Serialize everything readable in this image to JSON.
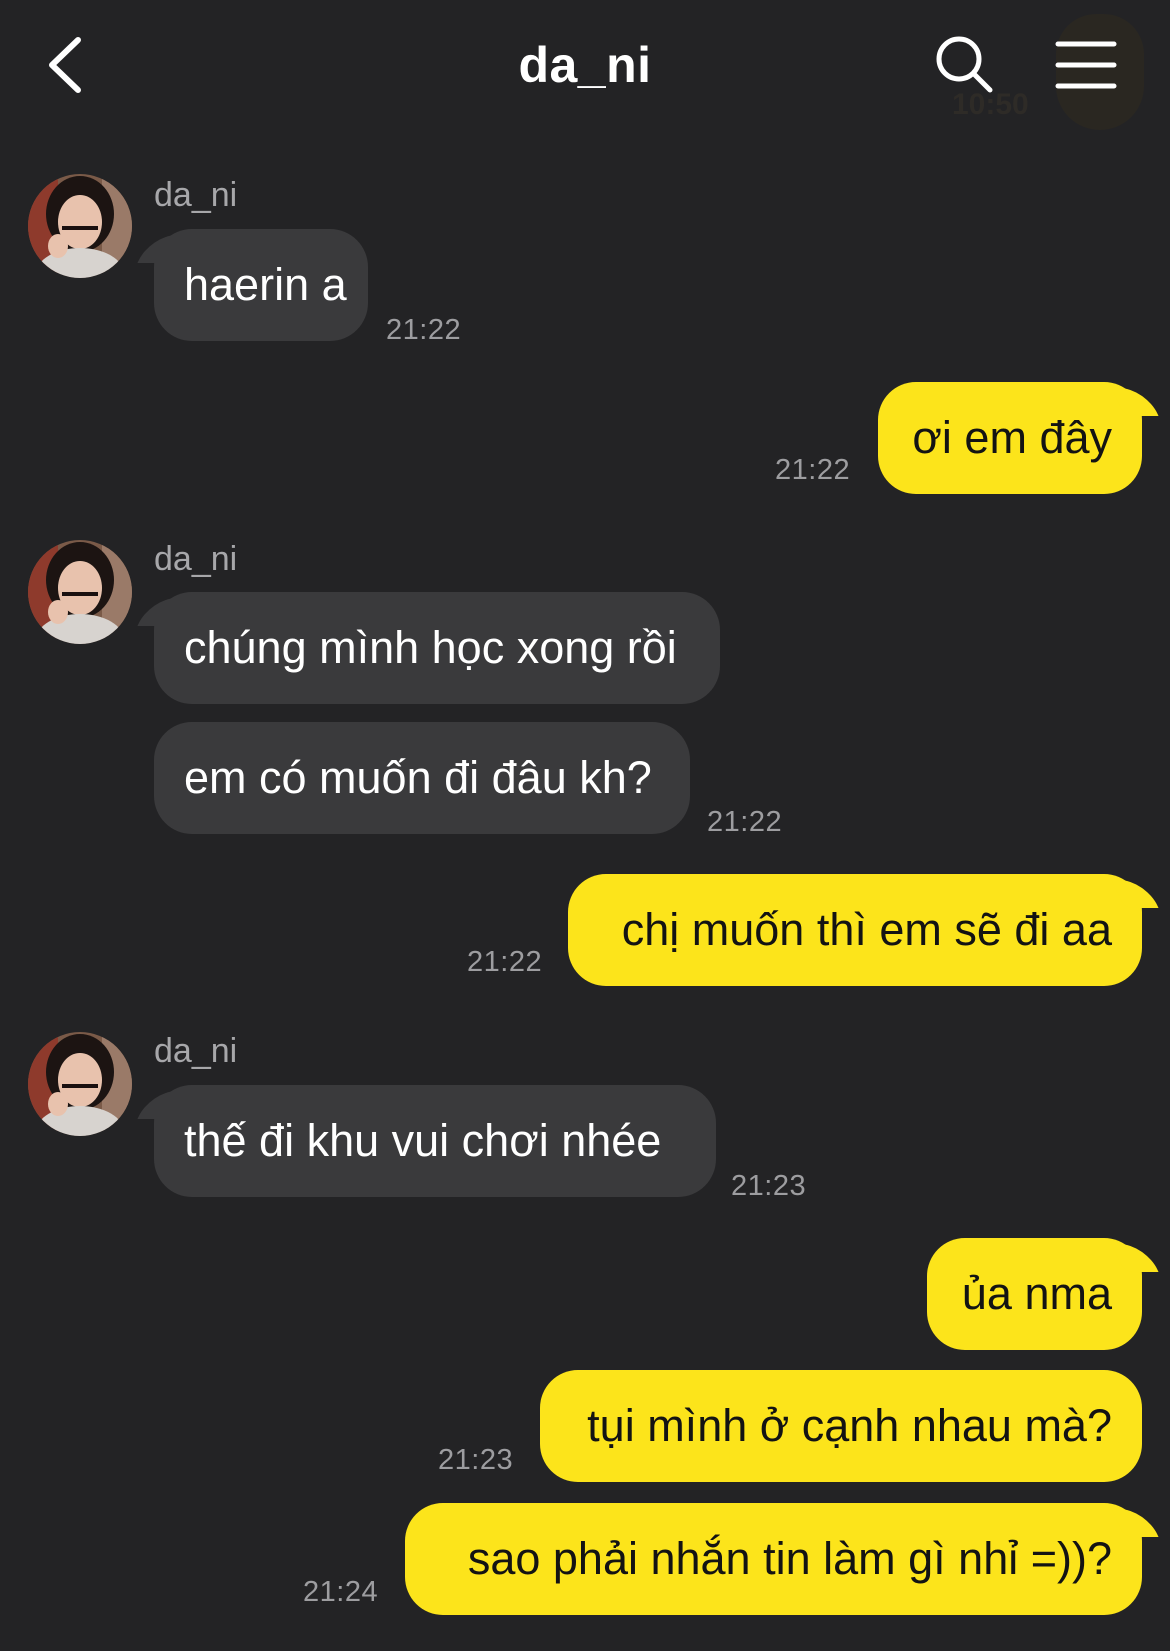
{
  "header": {
    "title": "da_ni",
    "status_time_faded": "10:50",
    "back_icon": "chevron-left-icon",
    "search_icon": "search-icon",
    "menu_icon": "hamburger-menu-icon"
  },
  "colors": {
    "background": "#232325",
    "incoming_bubble": "#3a3a3c",
    "outgoing_bubble": "#fce41b",
    "timestamp": "#9d9da0"
  },
  "messages": {
    "g1": {
      "sender": "da_ni",
      "texts": [
        "haerin a"
      ],
      "time": "21:22"
    },
    "g2": {
      "texts": [
        "ơi em đây"
      ],
      "time": "21:22"
    },
    "g3": {
      "sender": "da_ni",
      "texts": [
        "chúng mình học xong rồi",
        "em có muốn đi đâu kh?"
      ],
      "time": "21:22"
    },
    "g4": {
      "texts": [
        "chị muốn thì em sẽ đi aa"
      ],
      "time": "21:22"
    },
    "g5": {
      "sender": "da_ni",
      "texts": [
        "thế đi khu vui chơi nhée"
      ],
      "time": "21:23"
    },
    "g6": {
      "texts": [
        "ủa nma",
        "tụi mình ở cạnh nhau mà?"
      ],
      "time": "21:23"
    },
    "g7": {
      "texts": [
        "sao phải nhắn tin làm gì nhỉ =))?"
      ],
      "time": "21:24"
    }
  }
}
